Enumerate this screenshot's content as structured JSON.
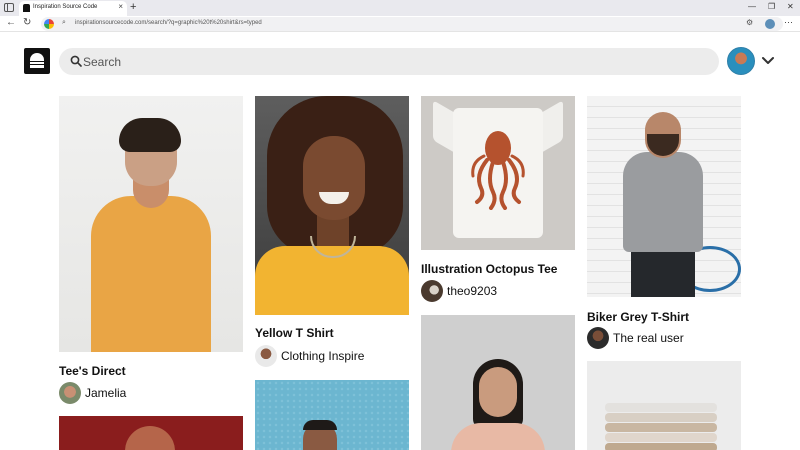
{
  "browser": {
    "tab_title": "Inspiration Source Code",
    "tab_close": "×",
    "new_tab": "+",
    "url": "inspirationsourcecode.com/search/?q=graphic%20t%20shirt&rs=typed",
    "window_controls": [
      "—",
      "❐",
      "✕"
    ],
    "nav": {
      "back": "←",
      "reload": "↻"
    }
  },
  "header": {
    "search_placeholder": "Search"
  },
  "pins": [
    {
      "title": "Tee's Direct",
      "user": "Jamelia"
    },
    {
      "title": "Yellow T Shirt",
      "user": "Clothing Inspire"
    },
    {
      "title": "Illustration Octopus Tee",
      "user": "theo9203"
    },
    {
      "title": "Biker Grey T-Shirt",
      "user": "The real user"
    }
  ],
  "colors": {
    "search_bg": "#ececec",
    "shirt_yellow": "#e9a545",
    "octopus": "#b5522e"
  }
}
